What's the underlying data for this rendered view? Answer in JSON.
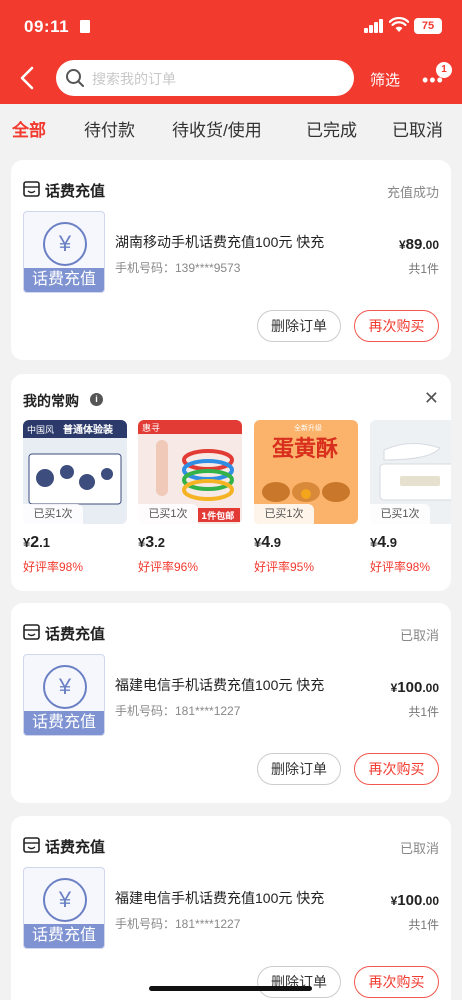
{
  "status_bar": {
    "time": "09:11",
    "battery": "75"
  },
  "header": {
    "search_placeholder": "搜索我的订单",
    "filter_label": "筛选",
    "more_badge": "1"
  },
  "tabs": [
    {
      "label": "全部",
      "active": true
    },
    {
      "label": "待付款",
      "active": false
    },
    {
      "label": "待收货/使用",
      "active": false
    },
    {
      "label": "已完成",
      "active": false
    },
    {
      "label": "已取消",
      "active": false
    }
  ],
  "orders": [
    {
      "shop": "话费充值",
      "status": "充值成功",
      "thumb_label": "话费充值",
      "yen_symbol": "¥",
      "title": "湖南移动手机话费充值100元 快充",
      "phone": "手机号码：139****9573",
      "price_symbol": "¥",
      "price_int": "89",
      "price_dec": ".00",
      "qty": "共1件",
      "delete_label": "删除订单",
      "rebuy_label": "再次购买"
    },
    {
      "shop": "话费充值",
      "status": "已取消",
      "thumb_label": "话费充值",
      "yen_symbol": "¥",
      "title": "福建电信手机话费充值100元 快充",
      "phone": "手机号码：181****1227",
      "price_symbol": "¥",
      "price_int": "100",
      "price_dec": ".00",
      "qty": "共1件",
      "delete_label": "删除订单",
      "rebuy_label": "再次购买"
    },
    {
      "shop": "话费充值",
      "status": "已取消",
      "thumb_label": "话费充值",
      "yen_symbol": "¥",
      "title": "福建电信手机话费充值100元 快充",
      "phone": "手机号码：181****1227",
      "price_symbol": "¥",
      "price_int": "100",
      "price_dec": ".00",
      "qty": "共1件",
      "delete_label": "删除订单",
      "rebuy_label": "再次购买"
    }
  ],
  "recommend": {
    "title": "我的常购",
    "info_icon": "i",
    "close_icon": "✕",
    "items": [
      {
        "bought": "已买1次",
        "price_symbol": "¥",
        "price_int": "2",
        "price_dec": ".1",
        "rating": "好评率98%",
        "img_tag": "中国风",
        "img_text": "普通体验装"
      },
      {
        "bought": "已买1次",
        "price_symbol": "¥",
        "price_int": "3",
        "price_dec": ".2",
        "rating": "好评率96%",
        "img_tag": "惠寻",
        "img_text": "1件包邮"
      },
      {
        "bought": "已买1次",
        "price_symbol": "¥",
        "price_int": "4",
        "price_dec": ".9",
        "rating": "好评率95%",
        "img_tag": "全新升级",
        "img_text": "蛋黄酥"
      },
      {
        "bought": "已买1次",
        "price_symbol": "¥",
        "price_int": "4",
        "price_dec": ".9",
        "rating": "好评率98%",
        "img_tag": "",
        "img_text": ""
      }
    ]
  }
}
